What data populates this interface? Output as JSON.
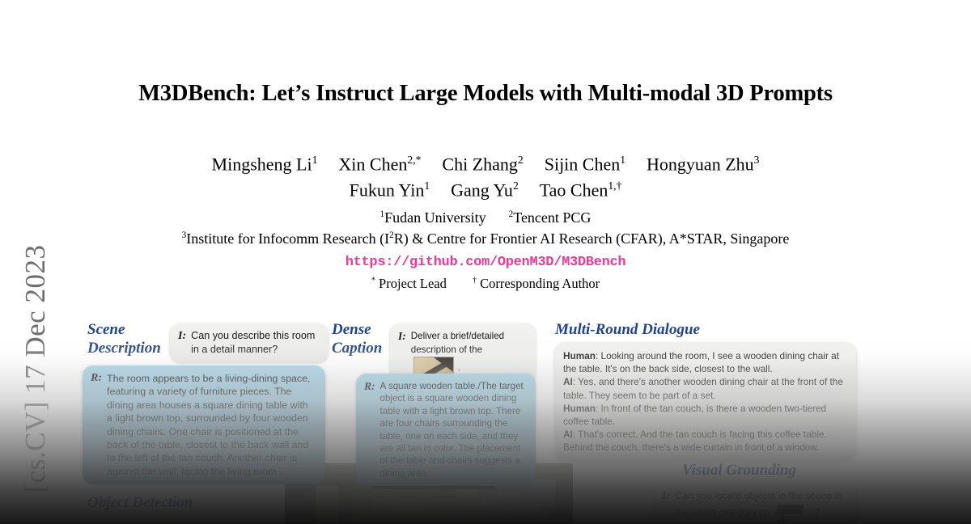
{
  "arxiv_stamp": "[cs.CV]  17 Dec 2023",
  "paper": {
    "title": "M3DBench: Let’s Instruct Large Models with Multi-modal 3D Prompts",
    "authors_row1": [
      {
        "name": "Mingsheng Li",
        "sup": "1"
      },
      {
        "name": "Xin Chen",
        "sup": "2,*"
      },
      {
        "name": "Chi Zhang",
        "sup": "2"
      },
      {
        "name": "Sijin Chen",
        "sup": "1"
      },
      {
        "name": "Hongyuan Zhu",
        "sup": "3"
      }
    ],
    "authors_row2": [
      {
        "name": "Fukun Yin",
        "sup": "1"
      },
      {
        "name": "Gang Yu",
        "sup": "2"
      },
      {
        "name": "Tao Chen",
        "sup": "1,†"
      }
    ],
    "affiliations_row1": [
      {
        "sup": "1",
        "name": "Fudan University"
      },
      {
        "sup": "2",
        "name": "Tencent PCG"
      }
    ],
    "affiliation_row2": {
      "sup": "3",
      "part_a": "Institute for Infocomm Research (I",
      "part_sup": "2",
      "part_b": "R) & Centre for Frontier AI Research (CFAR), A*STAR, Singapore"
    },
    "project_url": "https://github.com/OpenM3D/M3DBench",
    "footnotes": [
      {
        "marker": "*",
        "text": "Project Lead"
      },
      {
        "marker": "†",
        "text": "Corresponding Author"
      }
    ]
  },
  "colors": {
    "section_title": "#21428c",
    "project_url": "#f2379b",
    "answer_bubble_top": "#a8d3e4",
    "answer_bubble_bottom": "#6d93a6",
    "prompt_bubble": "#ececeb"
  },
  "teaser": {
    "scene_description": {
      "title": "Scene\nDescription",
      "prompt_tag": "I:",
      "prompt_text": "Can you describe this room in a detail manner?",
      "answer_tag": "R:",
      "answer_text": "The room appears to be a living-dining space, featuring a variety of furniture pieces. The dining area houses a square dining table with a light brown top, surrounded by four wooden dining chairs. One chair is positioned at the back of the table, closest to the back wall and to the left of the tan couch. Another chair is against the wall, facing the living room..."
    },
    "dense_caption": {
      "title": "Dense\nCaption",
      "prompt_tag": "I:",
      "prompt_text_before": "Deliver a brief/detailed description of the",
      "prompt_image": "table-thumbnail",
      "prompt_text_after": ".",
      "answer_tag": "R:",
      "answer_text": "A square wooden table./The target object is a square wooden dining table with a light brown top. There are four chairs surrounding the table, one on each side, and they are all tan in color. The placement of the table and chairs suggests a dining area..."
    },
    "multi_round_dialogue": {
      "title": "Multi-Round Dialogue",
      "turns": [
        {
          "speaker": "Human",
          "text": ": Looking around the room, I see a wooden dining chair at the table. It's on the back side, closest to the wall."
        },
        {
          "speaker": "AI",
          "text": ": Yes, and there's another wooden dining chair at the front of the table. They seem to be part of a set."
        },
        {
          "speaker": "Human",
          "text": ": In front of the tan couch, is there a wooden two-tiered coffee table."
        },
        {
          "speaker": "AI",
          "text": ":  That's correct. And the tan couch is facing this coffee table. Behind the couch, there's a wide curtain in front of a window."
        }
      ]
    },
    "visual_grounding": {
      "title": "Visual Grounding",
      "prompt_tag": "I:",
      "prompt_text_before": "Can you locate objects in the scene in the same category as",
      "prompt_image": "chair-thumbnail",
      "prompt_text_after": "?"
    },
    "object_detection": {
      "title": "Object Detection"
    }
  }
}
